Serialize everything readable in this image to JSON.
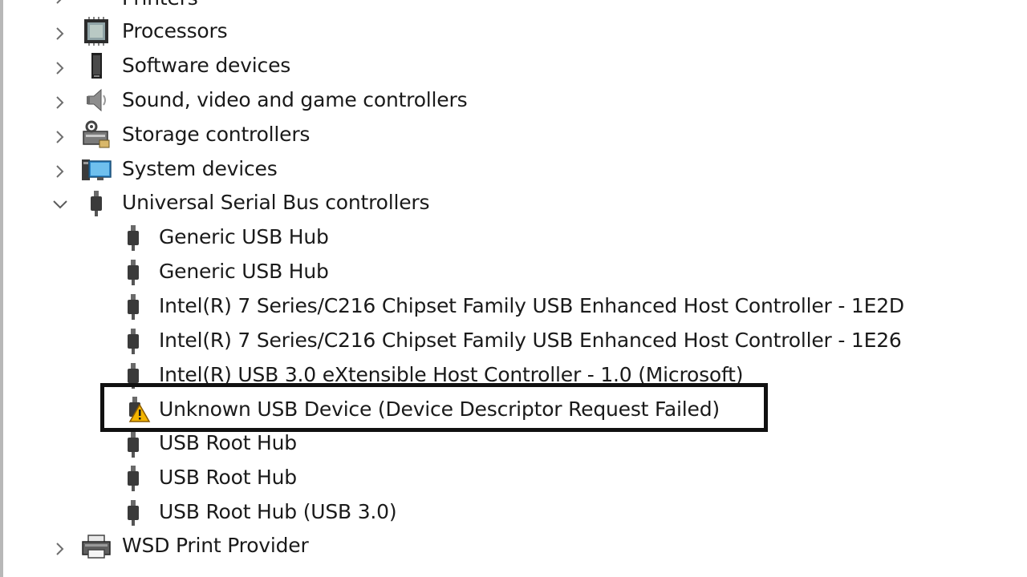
{
  "tree": {
    "partial_top_label": "Printers",
    "categories": [
      {
        "label": "Processors",
        "icon": "processor-icon",
        "expanded": false
      },
      {
        "label": "Software devices",
        "icon": "software-device-icon",
        "expanded": false
      },
      {
        "label": "Sound, video and game controllers",
        "icon": "speaker-icon",
        "expanded": false
      },
      {
        "label": "Storage controllers",
        "icon": "storage-controller-icon",
        "expanded": false
      },
      {
        "label": "System devices",
        "icon": "system-device-icon",
        "expanded": false
      },
      {
        "label": "Universal Serial Bus controllers",
        "icon": "usb-icon",
        "expanded": true
      },
      {
        "label": "WSD Print Provider",
        "icon": "printer-icon",
        "expanded": false
      }
    ],
    "usb_children": [
      {
        "label": "Generic USB Hub",
        "icon": "usb-icon",
        "warning": false
      },
      {
        "label": "Generic USB Hub",
        "icon": "usb-icon",
        "warning": false
      },
      {
        "label": "Intel(R) 7 Series/C216 Chipset Family USB Enhanced Host Controller - 1E2D",
        "icon": "usb-icon",
        "warning": false
      },
      {
        "label": "Intel(R) 7 Series/C216 Chipset Family USB Enhanced Host Controller - 1E26",
        "icon": "usb-icon",
        "warning": false
      },
      {
        "label": "Intel(R) USB 3.0 eXtensible Host Controller - 1.0 (Microsoft)",
        "icon": "usb-icon",
        "warning": false
      },
      {
        "label": "Unknown USB Device (Device Descriptor Request Failed)",
        "icon": "usb-warning-icon",
        "warning": true
      },
      {
        "label": "USB Root Hub",
        "icon": "usb-icon",
        "warning": false
      },
      {
        "label": "USB Root Hub",
        "icon": "usb-icon",
        "warning": false
      },
      {
        "label": "USB Root Hub (USB 3.0)",
        "icon": "usb-icon",
        "warning": false
      }
    ]
  },
  "colors": {
    "highlight_border": "#111111",
    "warning": "#f2b400",
    "usb_icon": "#3a3a3a"
  }
}
